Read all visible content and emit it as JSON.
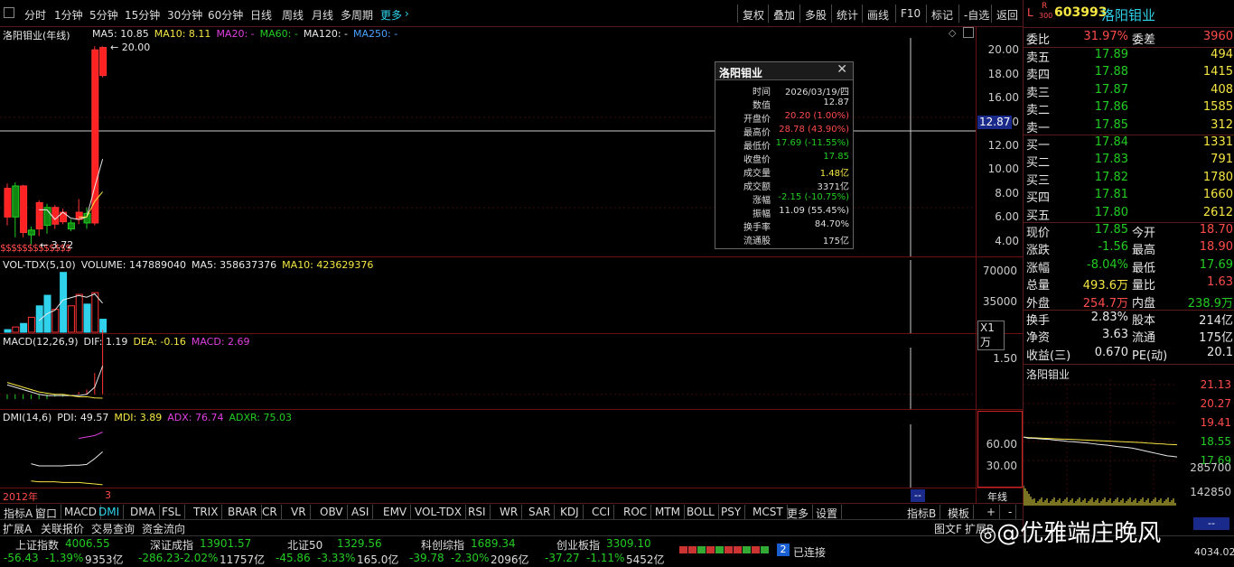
{
  "toolbar": {
    "periods": [
      "分时",
      "1分钟",
      "5分钟",
      "15分钟",
      "30分钟",
      "60分钟",
      "日线",
      "周线",
      "月线",
      "多周期",
      "更多"
    ],
    "tools": [
      "复权",
      "叠加",
      "多股",
      "统计",
      "画线",
      "F10",
      "标记",
      "-自选",
      "返回"
    ]
  },
  "main_chart": {
    "stock_title": "洛阳钼业(年线)",
    "ma_labels": [
      {
        "text": "MA5: 10.85",
        "color": "#e8e8e8"
      },
      {
        "text": "MA10: 8.11",
        "color": "#f5e642"
      },
      {
        "text": "MA20: -",
        "color": "#e040e0"
      },
      {
        "text": "MA60: -",
        "color": "#22cc22"
      },
      {
        "text": "MA120: -",
        "color": "#e8e8e8"
      },
      {
        "text": "MA250: -",
        "color": "#4aa0ff"
      }
    ],
    "high_mark": "20.00",
    "low_mark": "3.72",
    "y_ticks": [
      "20.00",
      "18.00",
      "16.00",
      "14.00",
      "12.00",
      "10.00",
      "8.00",
      "6.00",
      "4.00"
    ],
    "crosshair_value": "12.87",
    "dividend_marks": "$$$$$$$$$$$$$",
    "x_start_label": "2012年",
    "x_cursor_label": "3",
    "x_crosshair_label": "--",
    "period_label": "年线"
  },
  "volume_chart": {
    "legend": [
      {
        "text": "VOL-TDX(5,10)",
        "color": "#e8e8e8"
      },
      {
        "text": "VOLUME: 147889040",
        "color": "#e8e8e8"
      },
      {
        "text": "MA5: 358637376",
        "color": "#e8e8e8"
      },
      {
        "text": "MA10: 423629376",
        "color": "#f5e642"
      }
    ],
    "y_ticks": [
      "70000",
      "35000"
    ],
    "unit": "X1万"
  },
  "macd_chart": {
    "legend": [
      {
        "text": "MACD(12,26,9)",
        "color": "#e8e8e8"
      },
      {
        "text": "DIF: 1.19",
        "color": "#e8e8e8"
      },
      {
        "text": "DEA: -0.16",
        "color": "#f5e642"
      },
      {
        "text": "MACD: 2.69",
        "color": "#e040e0"
      }
    ],
    "y_ticks": [
      "1.50"
    ]
  },
  "dmi_chart": {
    "legend": [
      {
        "text": "DMI(14,6)",
        "color": "#e8e8e8"
      },
      {
        "text": "PDI: 49.57",
        "color": "#e8e8e8"
      },
      {
        "text": "MDI: 3.89",
        "color": "#f5e642"
      },
      {
        "text": "ADX: 76.74",
        "color": "#e040e0"
      },
      {
        "text": "ADXR: 75.03",
        "color": "#22cc22"
      }
    ],
    "y_ticks": [
      "60.00",
      "30.00"
    ]
  },
  "popup": {
    "title": "洛阳钼业",
    "rows": [
      {
        "k": "时间",
        "v": "2026/03/19/四",
        "c": "#dddddd"
      },
      {
        "k": "数值",
        "v": "12.87",
        "c": "#dddddd"
      },
      {
        "k": "开盘价",
        "v": "20.20 (1.00%)",
        "c": "#ff4b4b"
      },
      {
        "k": "最高价",
        "v": "28.78 (43.90%)",
        "c": "#ff4b4b"
      },
      {
        "k": "最低价",
        "v": "17.69 (-11.55%)",
        "c": "#22cc22"
      },
      {
        "k": "收盘价",
        "v": "17.85",
        "c": "#22cc22"
      },
      {
        "k": "成交量",
        "v": "1.48亿",
        "c": "#f5e642"
      },
      {
        "k": "成交额",
        "v": "3371亿",
        "c": "#dddddd"
      },
      {
        "k": "涨幅",
        "v": "-2.15 (-10.75%)",
        "c": "#22cc22"
      },
      {
        "k": "振幅",
        "v": "11.09 (55.45%)",
        "c": "#dddddd"
      },
      {
        "k": "换手率",
        "v": "84.70%",
        "c": "#dddddd"
      },
      {
        "k": "流通股",
        "v": "175亿",
        "c": "#dddddd"
      }
    ]
  },
  "quote": {
    "badge_l": "L",
    "badge_r": "R",
    "badge_300": "300",
    "code": "603993",
    "name": "洛阳钼业",
    "weibi_label": "委比",
    "weibi_value": "31.97%",
    "weicha_label": "委差",
    "weicha_value": "3960",
    "asks": [
      {
        "label": "卖五",
        "price": "17.89",
        "vol": "494"
      },
      {
        "label": "卖四",
        "price": "17.88",
        "vol": "1415"
      },
      {
        "label": "卖三",
        "price": "17.87",
        "vol": "408"
      },
      {
        "label": "卖二",
        "price": "17.86",
        "vol": "1585"
      },
      {
        "label": "卖一",
        "price": "17.85",
        "vol": "312"
      }
    ],
    "bids": [
      {
        "label": "买一",
        "price": "17.84",
        "vol": "1331"
      },
      {
        "label": "买二",
        "price": "17.83",
        "vol": "791"
      },
      {
        "label": "买三",
        "price": "17.82",
        "vol": "1780"
      },
      {
        "label": "买四",
        "price": "17.81",
        "vol": "1660"
      },
      {
        "label": "买五",
        "price": "17.80",
        "vol": "2612"
      }
    ],
    "stats": [
      {
        "l1": "现价",
        "v1": "17.85",
        "c1": "#22cc22",
        "l2": "今开",
        "v2": "18.70",
        "c2": "#ff4b4b"
      },
      {
        "l1": "涨跌",
        "v1": "-1.56",
        "c1": "#22cc22",
        "l2": "最高",
        "v2": "18.90",
        "c2": "#ff4b4b"
      },
      {
        "l1": "涨幅",
        "v1": "-8.04%",
        "c1": "#22cc22",
        "l2": "最低",
        "v2": "17.69",
        "c2": "#22cc22"
      },
      {
        "l1": "总量",
        "v1": "493.6万",
        "c1": "#f5e642",
        "l2": "量比",
        "v2": "1.63",
        "c2": "#ff4b4b"
      },
      {
        "l1": "外盘",
        "v1": "254.7万",
        "c1": "#ff4b4b",
        "l2": "内盘",
        "v2": "238.9万",
        "c2": "#22cc22"
      }
    ],
    "stats2": [
      {
        "l1": "换手",
        "v1": "2.83%",
        "c1": "#e8e8e8",
        "l2": "股本",
        "v2": "214亿",
        "c2": "#e8e8e8"
      },
      {
        "l1": "净资",
        "v1": "3.63",
        "c1": "#e8e8e8",
        "l2": "流通",
        "v2": "175亿",
        "c2": "#e8e8e8"
      },
      {
        "l1": "收益(三)",
        "v1": "0.670",
        "c1": "#e8e8e8",
        "l2": "PE(动)",
        "v2": "20.1",
        "c2": "#e8e8e8"
      }
    ]
  },
  "intraday": {
    "title": "洛阳钼业",
    "price_ticks": [
      "21.13",
      "20.27",
      "19.41",
      "18.55",
      "17.69"
    ],
    "vol_ticks": [
      "285700",
      "142850"
    ],
    "crosshair_value": "--"
  },
  "indicator_tabs": [
    "指标A",
    "窗口",
    "MACD",
    "DMI",
    "DMA",
    "FSL",
    "TRIX",
    "BRAR",
    "CR",
    "VR",
    "OBV",
    "ASI",
    "EMV",
    "VOL-TDX",
    "RSI",
    "WR",
    "SAR",
    "KDJ",
    "CCI",
    "ROC",
    "MTM",
    "BOLL",
    "PSY",
    "MCST",
    "更多",
    "设置"
  ],
  "indicator_b": [
    "指标B",
    "模板",
    "+",
    "-"
  ],
  "footer_tabs": [
    "扩展A",
    "关联报价",
    "交易查询",
    "资金流向"
  ],
  "footer_right": [
    "图文F",
    "扩展B"
  ],
  "indices": [
    {
      "name": "上证指数",
      "value": "4006.55",
      "chg": "-56.43",
      "pct": "-1.39%",
      "amt": "9353亿"
    },
    {
      "name": "深证成指",
      "value": "13901.57",
      "chg": "-286.23",
      "pct": "-2.02%",
      "amt": "11757亿"
    },
    {
      "name": "北证50",
      "value": "1329.56",
      "chg": "-45.86",
      "pct": "-3.33%",
      "amt": "165.0亿"
    },
    {
      "name": "科创综指",
      "value": "1689.34",
      "chg": "-39.78",
      "pct": "-2.30%",
      "amt": "2096亿"
    },
    {
      "name": "创业板指",
      "value": "3309.10",
      "chg": "-37.27",
      "pct": "-1.11%",
      "amt": "5452亿"
    }
  ],
  "connection": {
    "number": "2",
    "label": "已连接"
  },
  "watermark": "@优雅端庄晚风",
  "corner_value": "4034.02",
  "chart_data": {
    "type": "candlestick",
    "price_candles": [
      {
        "o": 8.4,
        "c": 6.0,
        "h": 8.8,
        "l": 5.3,
        "color": "red"
      },
      {
        "o": 6.0,
        "c": 8.6,
        "h": 8.9,
        "l": 4.3,
        "color": "green"
      },
      {
        "o": 8.6,
        "c": 4.7,
        "h": 8.7,
        "l": 4.3,
        "color": "red"
      },
      {
        "o": 4.5,
        "c": 4.9,
        "h": 5.2,
        "l": 3.7,
        "color": "green"
      },
      {
        "o": 5.0,
        "c": 7.2,
        "h": 7.4,
        "l": 4.4,
        "color": "red"
      },
      {
        "o": 6.8,
        "c": 5.3,
        "h": 7.1,
        "l": 4.6,
        "color": "green"
      },
      {
        "o": 5.4,
        "c": 6.8,
        "h": 7.0,
        "l": 5.0,
        "color": "red"
      },
      {
        "o": 5.6,
        "c": 6.4,
        "h": 6.7,
        "l": 5.4,
        "color": "red"
      },
      {
        "o": 5.5,
        "c": 5.0,
        "h": 5.8,
        "l": 4.8,
        "color": "green"
      },
      {
        "o": 5.8,
        "c": 6.4,
        "h": 7.5,
        "l": 5.4,
        "color": "red"
      },
      {
        "o": 6.3,
        "c": 5.5,
        "h": 6.8,
        "l": 5.0,
        "color": "green"
      },
      {
        "o": 5.5,
        "c": 20.0,
        "h": 20.3,
        "l": 5.3,
        "color": "red"
      },
      {
        "o": 20.2,
        "c": 17.85,
        "h": 20.3,
        "l": 17.7,
        "color": "red"
      }
    ],
    "ma5": [
      null,
      null,
      null,
      null,
      6.6,
      6.6,
      5.8,
      6.4,
      5.9,
      5.8,
      6.0,
      8.5,
      10.85
    ],
    "ma10": [
      null,
      null,
      null,
      null,
      null,
      null,
      null,
      null,
      null,
      6.0,
      6.0,
      7.3,
      8.11
    ],
    "volume": [
      3000,
      6000,
      10000,
      17000,
      30000,
      42000,
      26000,
      68000,
      30000,
      43000,
      32000,
      45000,
      14800
    ],
    "volume_colors": [
      "cyan",
      "red",
      "cyan",
      "red",
      "cyan",
      "cyan",
      "red",
      "cyan",
      "red",
      "red",
      "cyan",
      "red",
      "cyan"
    ],
    "dif": [
      0.4,
      0.3,
      0.2,
      0.1,
      0.0,
      -0.05,
      -0.05,
      -0.05,
      -0.05,
      -0.05,
      0.0,
      0.3,
      1.19
    ],
    "dea": [
      0.5,
      0.4,
      0.3,
      0.2,
      0.1,
      0.05,
      0.0,
      0.0,
      -0.05,
      -0.1,
      -0.1,
      -0.15,
      -0.16
    ],
    "pdi": [
      null,
      null,
      null,
      33,
      30,
      30,
      30,
      30,
      31,
      31,
      32,
      40,
      49.57
    ],
    "mdi": [
      null,
      null,
      null,
      9,
      8,
      8,
      8,
      7,
      7,
      7,
      6,
      5,
      3.89
    ],
    "adx": [
      null,
      null,
      null,
      null,
      null,
      null,
      null,
      null,
      null,
      68,
      70,
      72,
      76.74
    ],
    "adxr": [
      null,
      null,
      null,
      null,
      null,
      null,
      null,
      null,
      null,
      null,
      null,
      null,
      75.03
    ],
    "intraday_price": [
      18.75,
      18.7,
      18.7,
      18.68,
      18.66,
      18.65,
      18.62,
      18.6,
      18.58,
      18.55,
      18.54,
      18.52,
      18.5,
      18.48,
      18.45,
      18.42,
      18.4,
      18.38,
      18.35,
      18.32,
      18.3,
      18.28,
      18.25,
      18.2,
      18.15,
      18.1,
      18.05,
      18.0,
      17.95,
      17.9,
      17.88,
      17.85
    ],
    "intraday_avg": [
      18.75,
      18.73,
      18.72,
      18.71,
      18.7,
      18.69,
      18.68,
      18.67,
      18.66,
      18.65,
      18.64,
      18.63,
      18.62,
      18.61,
      18.6,
      18.59,
      18.58,
      18.57,
      18.56,
      18.55,
      18.54,
      18.53,
      18.52,
      18.51,
      18.5,
      18.48,
      18.47,
      18.45,
      18.44,
      18.42,
      18.41,
      18.4
    ],
    "price_ylim": [
      3.0,
      21.0
    ],
    "volume_ylim": [
      0,
      80000
    ],
    "macd_ylim": [
      -0.5,
      2.0
    ],
    "dmi_ylim": [
      0,
      90
    ]
  }
}
